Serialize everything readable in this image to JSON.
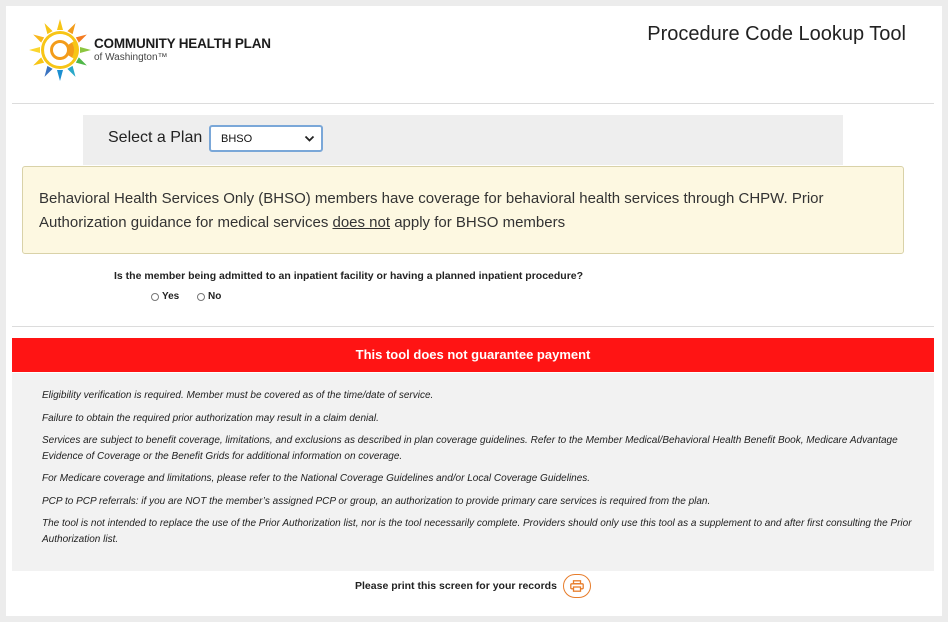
{
  "header": {
    "logo_name": "COMMUNITY HEALTH PLAN",
    "logo_sub": "of Washington™",
    "title": "Procedure Code Lookup Tool"
  },
  "plan": {
    "label": "Select a Plan",
    "selected": "BHSO"
  },
  "notice": {
    "text_before": "Behavioral Health Services Only (BHSO) members have coverage for behavioral health services through CHPW. Prior Authorization guidance for medical services ",
    "underlined": "does not",
    "text_after": " apply for BHSO members"
  },
  "inpatient": {
    "question": "Is the member being admitted to an inpatient facility or having a planned inpatient procedure?",
    "yes_label": "Yes",
    "no_label": "No"
  },
  "warning": "This tool does not guarantee payment",
  "disclaimers": [
    "Eligibility verification is required. Member must be covered as of the time/date of service.",
    "Failure to obtain the required prior authorization may result in a claim denial.",
    "Services are subject to benefit coverage, limitations, and exclusions as described in plan coverage guidelines. Refer to the Member Medical/Behavioral Health Benefit Book, Medicare Advantage Evidence of Coverage or the Benefit Grids for additional information on coverage.",
    "For Medicare coverage and limitations, please refer to the National Coverage Guidelines and/or Local Coverage Guidelines.",
    "PCP to PCP referrals: if you are NOT the member’s assigned PCP or group, an authorization to provide primary care services is required from the plan.",
    "The tool is not intended to replace the use of the Prior Authorization list, nor is the tool necessarily complete. Providers should only use this tool as a supplement to and after first consulting the Prior Authorization list."
  ],
  "print": {
    "text": "Please print this screen for your records"
  },
  "colors": {
    "warning_red": "#ff1414",
    "notice_bg": "#fdf8e1",
    "print_accent": "#e77c2a",
    "select_border": "#7aa7d8"
  },
  "icons": {
    "logo": "sunburst-logo-icon",
    "select": "chevron-down-icon",
    "print": "printer-icon"
  }
}
